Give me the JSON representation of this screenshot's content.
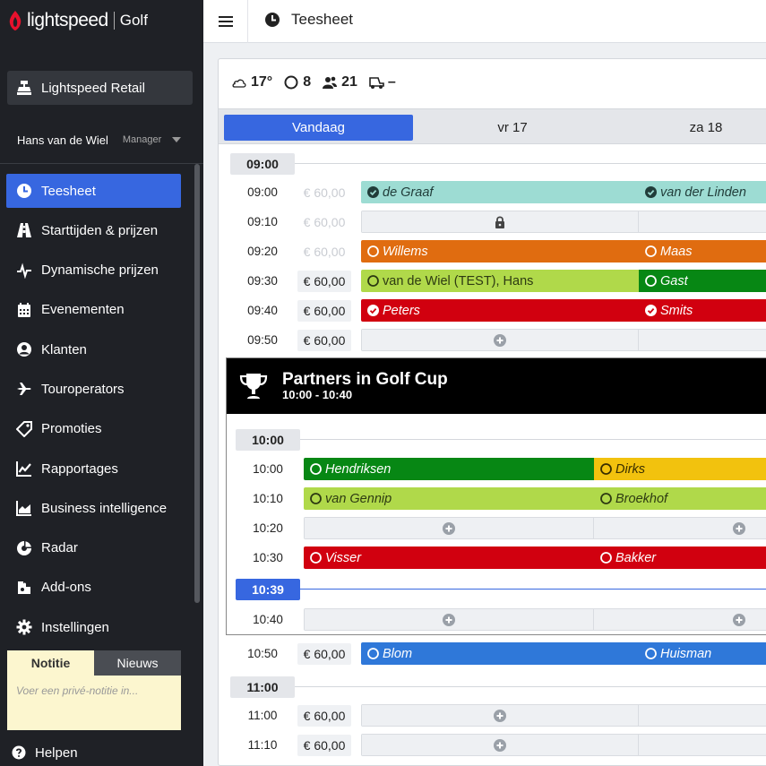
{
  "brand": {
    "name": "lightspeed",
    "product": "Golf",
    "accent": "#3767e0",
    "logo_red": "#e8112d"
  },
  "sidebar": {
    "retail_label": "Lightspeed Retail",
    "user_name": "Hans van de Wiel",
    "user_role": "Manager",
    "items": [
      {
        "label": "Teesheet",
        "icon": "clock-icon",
        "active": true
      },
      {
        "label": "Starttijden & prijzen",
        "icon": "road-icon",
        "active": false
      },
      {
        "label": "Dynamische prijzen",
        "icon": "pulse-icon",
        "active": false
      },
      {
        "label": "Evenementen",
        "icon": "calendar-icon",
        "active": false
      },
      {
        "label": "Klanten",
        "icon": "user-circle-icon",
        "active": false
      },
      {
        "label": "Touroperators",
        "icon": "plane-icon",
        "active": false
      },
      {
        "label": "Promoties",
        "icon": "tag-icon",
        "active": false
      },
      {
        "label": "Rapportages",
        "icon": "line-chart-icon",
        "active": false
      },
      {
        "label": "Business intelligence",
        "icon": "area-chart-icon",
        "active": false
      },
      {
        "label": "Radar",
        "icon": "radar-icon",
        "active": false
      },
      {
        "label": "Add-ons",
        "icon": "puzzle-icon",
        "active": false
      },
      {
        "label": "Instellingen",
        "icon": "gear-icon",
        "active": false
      }
    ],
    "notes": {
      "tab_notitie": "Notitie",
      "tab_nieuws": "Nieuws",
      "placeholder": "Voer een privé-notitie in..."
    },
    "help_label": "Helpen"
  },
  "topbar": {
    "title": "Teesheet"
  },
  "weather": {
    "temp": "17°",
    "slots": "8",
    "players": "21",
    "carts": "–"
  },
  "days": [
    {
      "label": "Vandaag",
      "active": true
    },
    {
      "label": "vr 17",
      "active": false
    },
    {
      "label": "za 18",
      "active": false
    }
  ],
  "price": "€ 60,00",
  "sections": {
    "s0900": "09:00",
    "s1000": "10:00",
    "now": "10:39",
    "s1100": "11:00"
  },
  "event": {
    "title": "Partners in Golf Cup",
    "time": "10:00 - 10:40"
  },
  "rows": [
    {
      "time": "09:00",
      "bookings": [
        "de Graaf",
        "van der Linden"
      ]
    },
    {
      "time": "09:10",
      "bookings": []
    },
    {
      "time": "09:20",
      "bookings": [
        "Willems",
        "Maas"
      ]
    },
    {
      "time": "09:30",
      "bookings": [
        "van de Wiel (TEST), Hans",
        "Gast"
      ]
    },
    {
      "time": "09:40",
      "bookings": [
        "Peters",
        "Smits"
      ]
    },
    {
      "time": "09:50",
      "bookings": []
    },
    {
      "time": "10:00",
      "bookings": [
        "Hendriksen",
        "Dirks"
      ]
    },
    {
      "time": "10:10",
      "bookings": [
        "van Gennip",
        "Broekhof"
      ]
    },
    {
      "time": "10:20",
      "bookings": []
    },
    {
      "time": "10:30",
      "bookings": [
        "Visser",
        "Bakker"
      ]
    },
    {
      "time": "10:40",
      "bookings": []
    },
    {
      "time": "10:50",
      "bookings": [
        "Blom",
        "Huisman"
      ]
    },
    {
      "time": "11:00",
      "bookings": []
    },
    {
      "time": "11:10",
      "bookings": []
    }
  ]
}
